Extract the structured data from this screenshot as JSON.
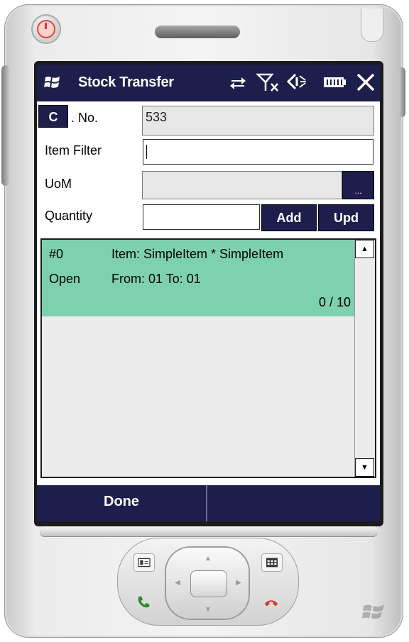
{
  "titlebar": {
    "app_title": "Stock Transfer",
    "icons": [
      "windows-start-icon",
      "connectivity-icon",
      "no-signal-icon",
      "speaker-icon",
      "battery-icon",
      "close-icon"
    ]
  },
  "form": {
    "c_button_label": "C",
    "doc_no_label": ". No.",
    "doc_no_value": "533",
    "item_filter_label": "Item Filter",
    "item_filter_value": "",
    "uom_label": "UoM",
    "uom_value": "",
    "uom_browse_label": "...",
    "quantity_label": "Quantity",
    "quantity_value": "",
    "add_label": "Add",
    "upd_label": "Upd"
  },
  "list": {
    "items": [
      {
        "index": "#0",
        "item": "Item: SimpleItem * SimpleItem",
        "status": "Open",
        "from_to": "From: 01 To: 01",
        "progress": "0 / 10"
      }
    ]
  },
  "softkeys": {
    "left": "Done",
    "right": ""
  },
  "colors": {
    "titlebar": "#1d1e4c",
    "selected_row": "#7dd1ae",
    "readonly_field": "#e7e7e7"
  }
}
